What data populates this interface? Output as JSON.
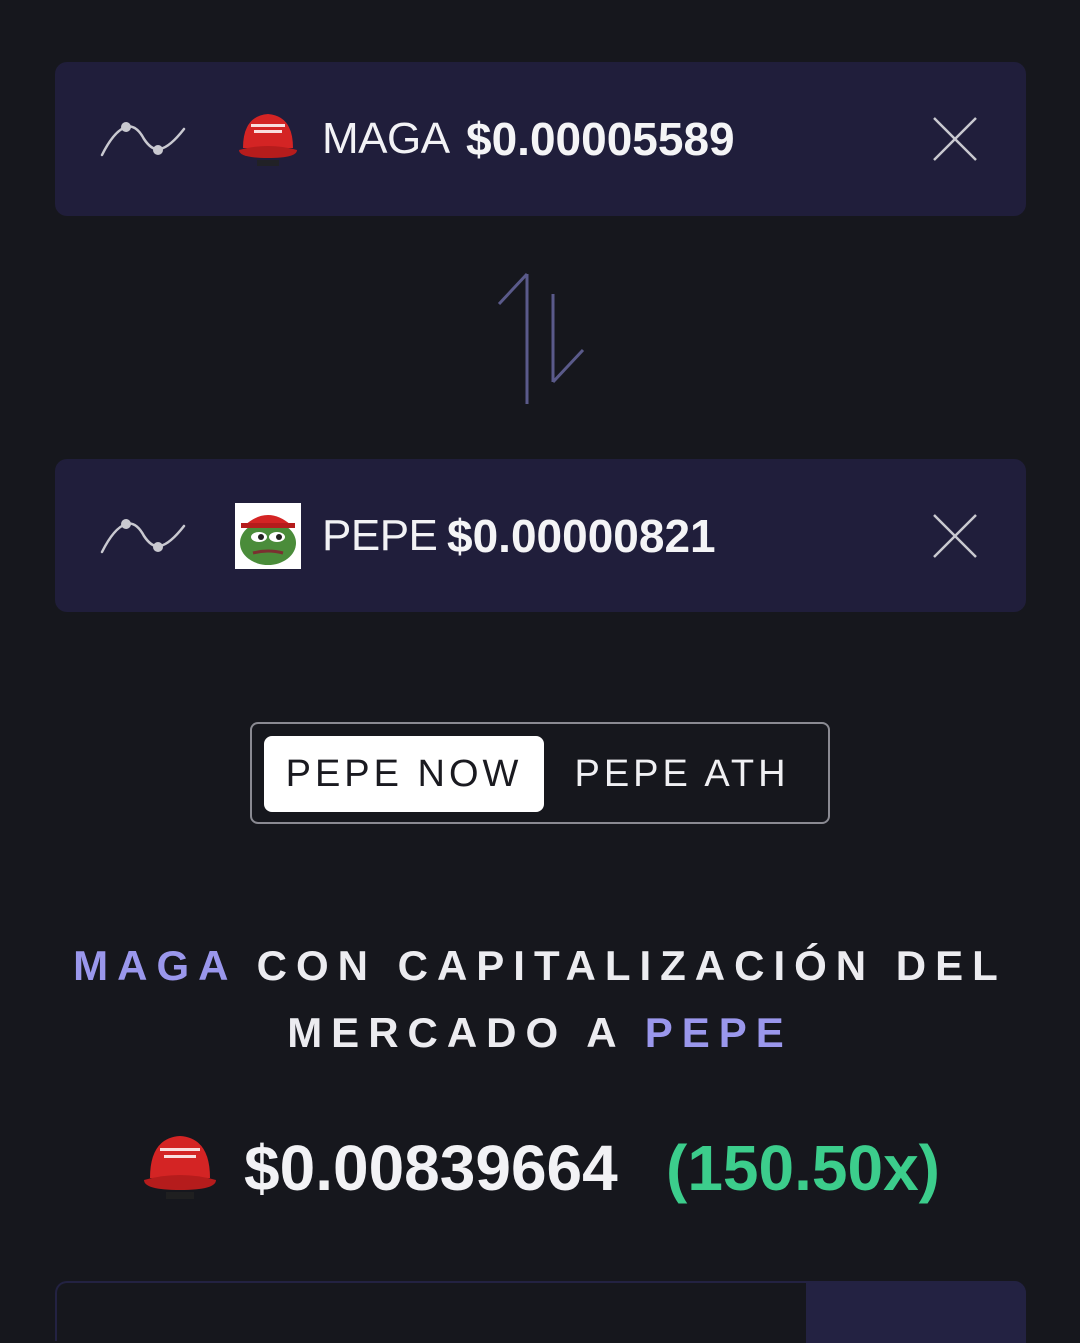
{
  "from_token": {
    "symbol": "MAGA",
    "price": "$0.00005589",
    "logo_icon": "maga-hat-icon",
    "chart_icon": "chart-icon",
    "close_icon": "close-icon"
  },
  "swap": {
    "icon": "swap-arrows-icon"
  },
  "to_token": {
    "symbol": "PEPE",
    "price": "$0.00000821",
    "logo_icon": "pepe-frog-icon",
    "chart_icon": "chart-icon",
    "close_icon": "close-icon"
  },
  "toggle": {
    "options": [
      "PEPE NOW",
      "PEPE ATH"
    ],
    "selected": "PEPE NOW"
  },
  "headline": {
    "token_a": "MAGA",
    "middle": " CON CAPITALIZACIÓN DEL MERCADO A ",
    "token_b": "PEPE"
  },
  "result": {
    "price": "$0.00839664",
    "multiplier": "(150.50x)"
  },
  "colors": {
    "background": "#16171d",
    "card": "#201e3b",
    "accent": "#9a97ec",
    "positive": "#3ccd8c"
  }
}
